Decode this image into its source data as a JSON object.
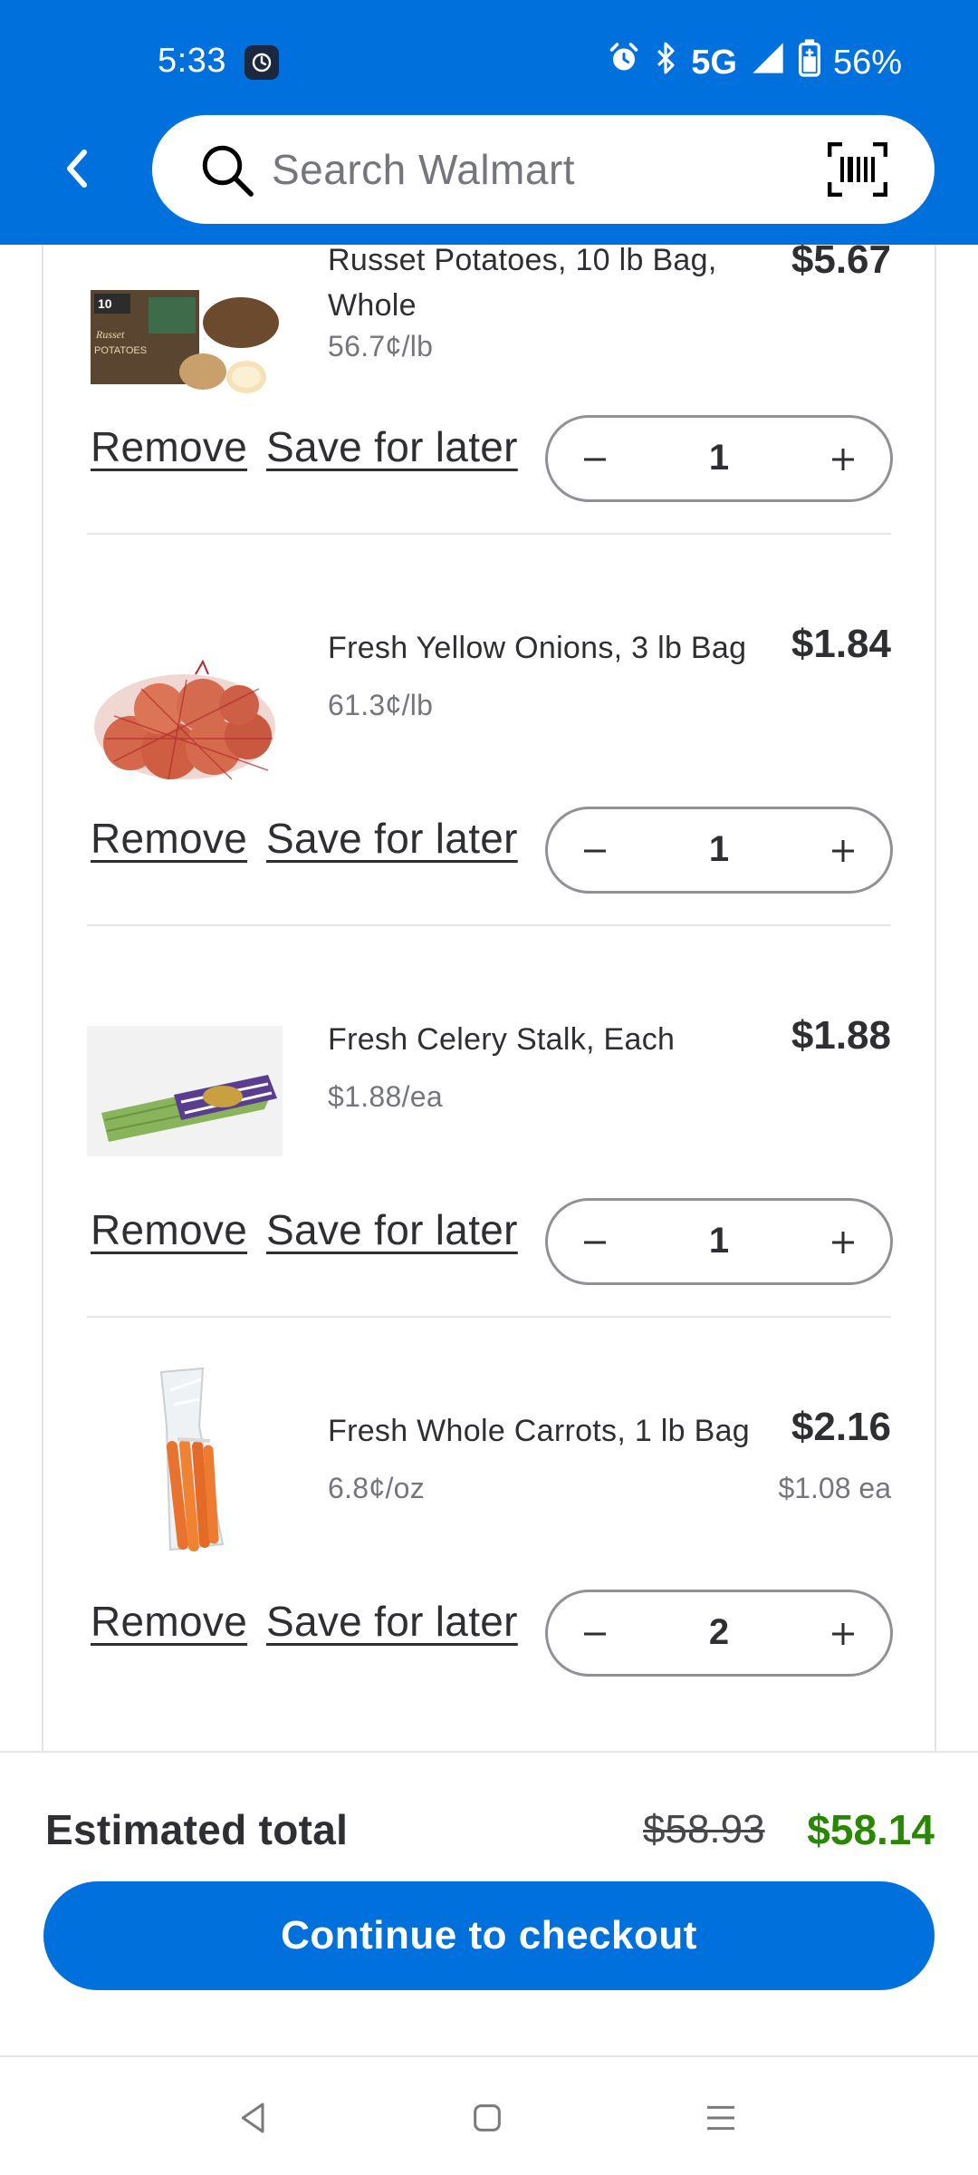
{
  "status_bar": {
    "time": "5:33",
    "network": "5G",
    "battery": "56%",
    "icons": [
      "messaging-app-icon",
      "alarm-icon",
      "bluetooth-icon",
      "signal-icon",
      "battery-icon"
    ]
  },
  "header": {
    "search_placeholder": "Search Walmart",
    "back_icon": "chevron-left-icon",
    "barcode_icon": "barcode-scan-icon"
  },
  "colors": {
    "brand_blue": "#0071dc",
    "savings_green": "#2a8703",
    "text_dark": "#2e2f32",
    "text_muted": "#74767c"
  },
  "cart": {
    "remove_label": "Remove",
    "save_label": "Save for later",
    "items": [
      {
        "name": "Russet Potatoes, 10 lb Bag, Whole",
        "unit_price": "56.7¢/lb",
        "price": "$5.67",
        "each": "",
        "qty": "1",
        "image": "russet-potatoes-bag"
      },
      {
        "name": "Fresh Yellow Onions, 3 lb Bag",
        "unit_price": "61.3¢/lb",
        "price": "$1.84",
        "each": "",
        "qty": "1",
        "image": "yellow-onions-net-bag"
      },
      {
        "name": "Fresh Celery Stalk, Each",
        "unit_price": "$1.88/ea",
        "price": "$1.88",
        "each": "",
        "qty": "1",
        "image": "celery-stalk"
      },
      {
        "name": "Fresh Whole Carrots, 1 lb Bag",
        "unit_price": "6.8¢/oz",
        "price": "$2.16",
        "each": "$1.08 ea",
        "qty": "2",
        "image": "carrots-bag"
      }
    ]
  },
  "footer": {
    "estimated_label": "Estimated total",
    "original_total": "$58.93",
    "total": "$58.14",
    "checkout_label": "Continue to checkout"
  },
  "nav": {
    "back": "nav-back-icon",
    "home": "nav-home-icon",
    "recents": "nav-recents-icon"
  }
}
